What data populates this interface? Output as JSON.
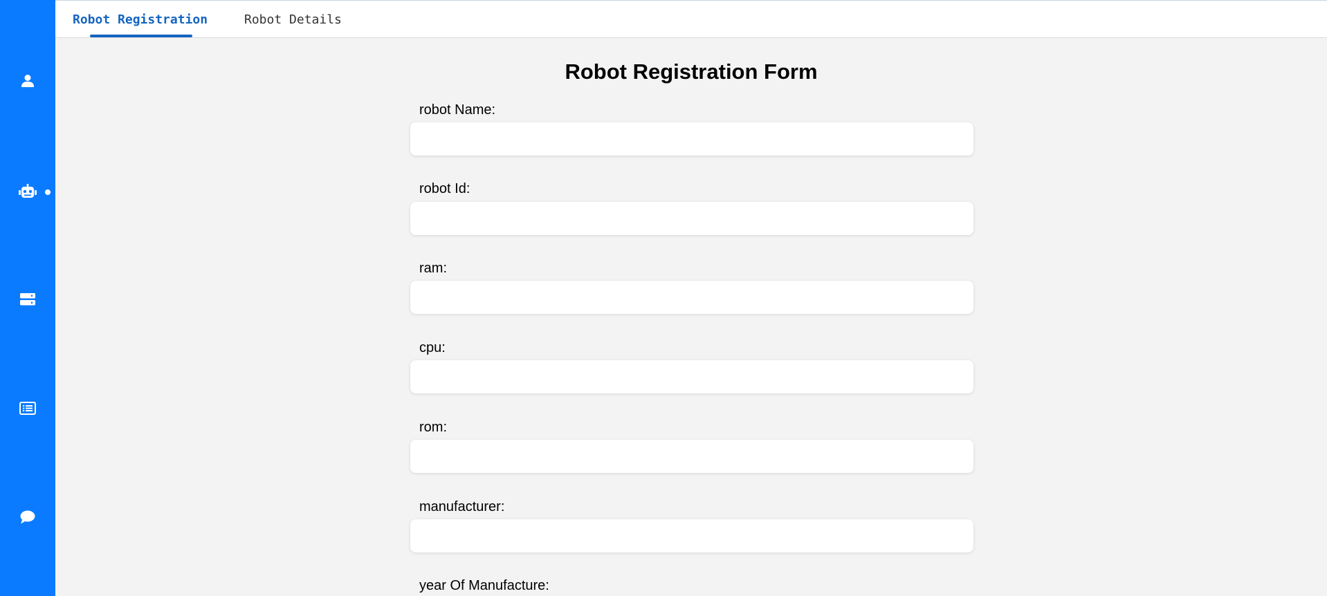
{
  "sidebar": {
    "items": [
      {
        "icon": "user-icon"
      },
      {
        "icon": "robot-icon",
        "active": true
      },
      {
        "icon": "server-icon"
      },
      {
        "icon": "list-icon"
      },
      {
        "icon": "chat-icon"
      }
    ],
    "color": "#0a7bff"
  },
  "tabs": {
    "items": [
      {
        "label": "Robot Registration",
        "active": true
      },
      {
        "label": "Robot Details",
        "active": false
      }
    ],
    "active_color": "#1565c0"
  },
  "form": {
    "title": "Robot Registration Form",
    "fields": [
      {
        "label": "robot Name:",
        "value": ""
      },
      {
        "label": "robot Id:",
        "value": ""
      },
      {
        "label": "ram:",
        "value": ""
      },
      {
        "label": "cpu:",
        "value": ""
      },
      {
        "label": "rom:",
        "value": ""
      },
      {
        "label": "manufacturer:",
        "value": ""
      },
      {
        "label": "year Of Manufacture:",
        "value": ""
      }
    ]
  }
}
